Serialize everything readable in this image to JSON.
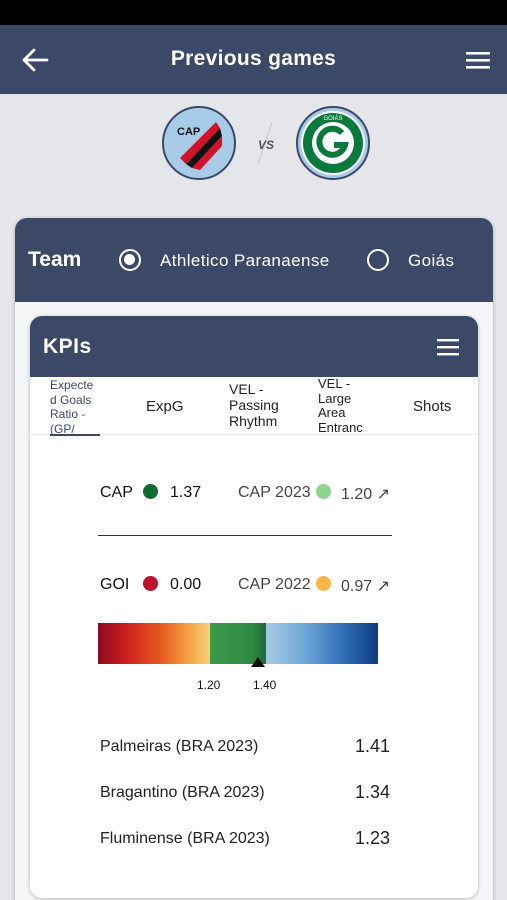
{
  "header": {
    "title": "Previous games"
  },
  "match": {
    "home_code": "CAP",
    "vs": "VS",
    "away_code": "GOIÁS"
  },
  "team_selector": {
    "label": "Team",
    "options": [
      {
        "label": "Athletico Paranaense",
        "selected": true
      },
      {
        "label": "Goiás",
        "selected": false
      }
    ]
  },
  "kpis": {
    "title": "KPIs",
    "tabs": [
      {
        "label": "Expecte\nd Goals\nRatio -\n(GP/",
        "active": true
      },
      {
        "label": "ExpG",
        "active": false
      },
      {
        "label": "VEL -\nPassing\nRhythm",
        "active": false
      },
      {
        "label": "VEL -\nLarge\nArea\nEntranc",
        "active": false
      },
      {
        "label": "Shots",
        "active": false
      }
    ],
    "legend": {
      "home": {
        "label": "CAP",
        "value": "1.37",
        "color": "#0f6b2e"
      },
      "season_a": {
        "label": "CAP 2023",
        "value": "1.20 ↗",
        "color": "#8fd48f"
      },
      "away": {
        "label": "GOI",
        "value": "0.00",
        "color": "#c0102c"
      },
      "season_b": {
        "label": "CAP 2022",
        "value": "0.97 ↗",
        "color": "#f9b44a"
      }
    },
    "scale": {
      "low_label": "1.20",
      "high_label": "1.40",
      "marker_value": 1.37
    },
    "comparisons": [
      {
        "team": "Palmeiras (BRA 2023)",
        "value": "1.41"
      },
      {
        "team": "Bragantino (BRA 2023)",
        "value": "1.34"
      },
      {
        "team": "Fluminense (BRA 2023)",
        "value": "1.23"
      }
    ]
  },
  "colors": {
    "header_bg": "#3b4868",
    "page_bg": "#e4e6ea"
  }
}
